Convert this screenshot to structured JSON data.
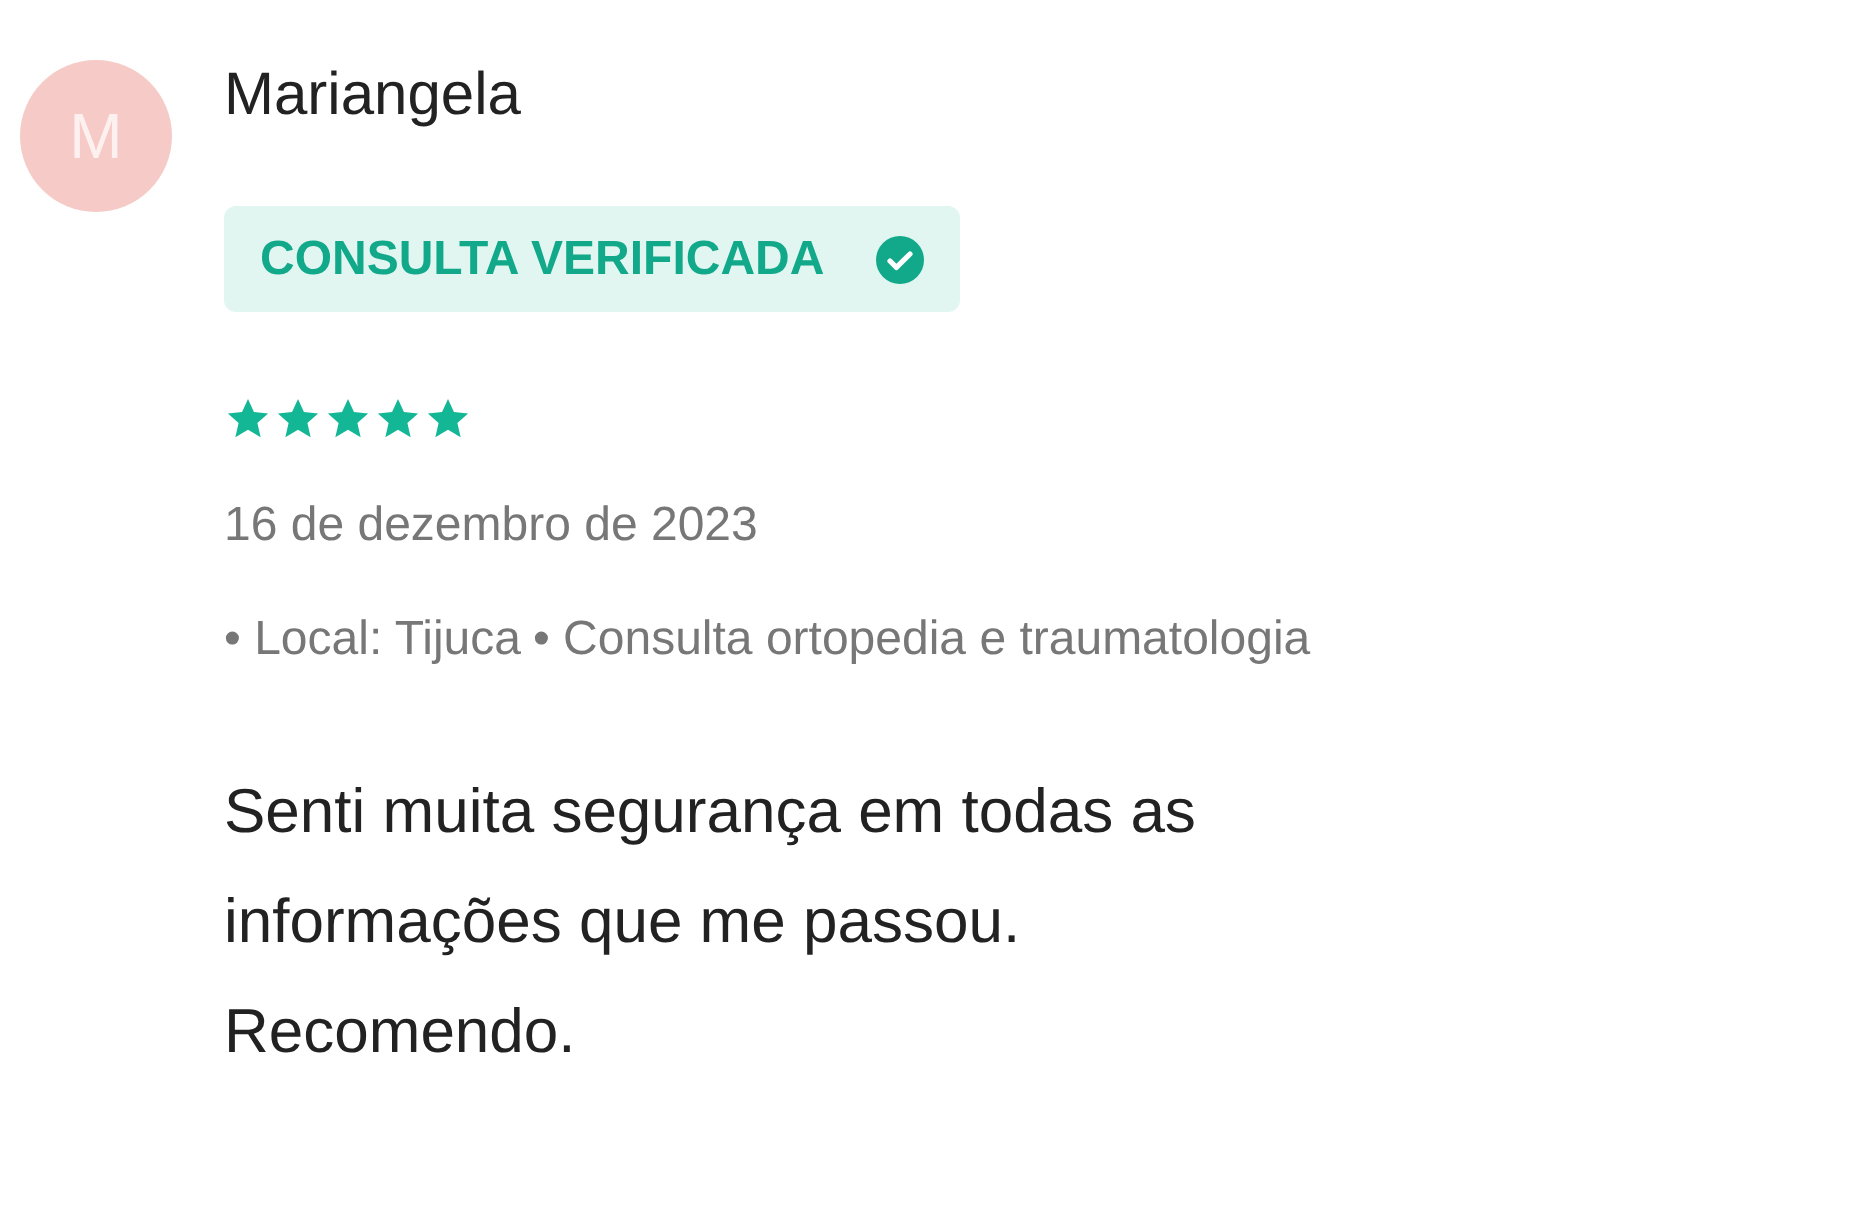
{
  "review": {
    "avatar_initial": "M",
    "author": "Mariangela",
    "badge": "CONSULTA VERIFICADA",
    "stars": 5,
    "date": "16 de dezembro de 2023",
    "details": [
      "• Local: Tijuca",
      "• Consulta ortopedia e traumatologia"
    ],
    "text": [
      "Senti muita segurança em todas as",
      "informações que me passou.",
      "Recomendo."
    ]
  }
}
